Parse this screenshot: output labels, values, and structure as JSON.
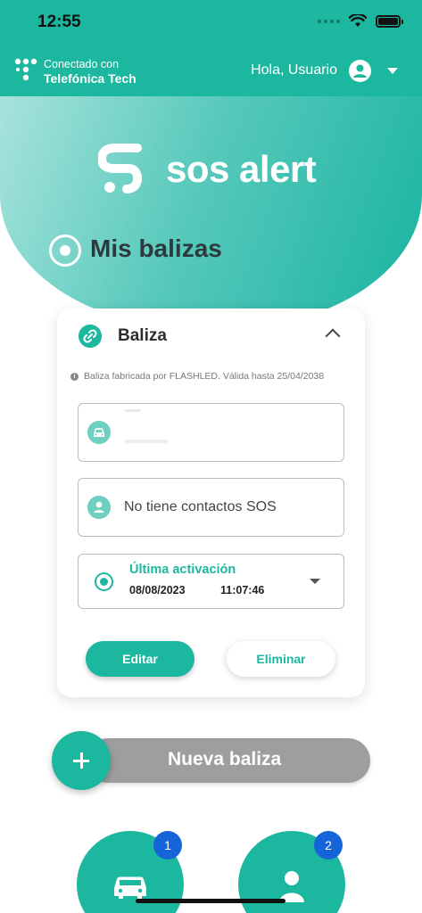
{
  "status_bar": {
    "time": "12:55"
  },
  "app_bar": {
    "brand_line1": "Conectado con",
    "brand_line2": "Telefónica Tech",
    "greeting": "Hola, Usuario"
  },
  "hero": {
    "logo_text": "sos alert",
    "section_title": "Mis balizas"
  },
  "beacon_card": {
    "title": "Baliza",
    "info": "Baliza fabricada por FLASHLED. Válida hasta 25/04/2038",
    "contacts_text": "No tiene contactos SOS",
    "activation_label": "Última activación",
    "activation_date": "08/08/2023",
    "activation_time": "11:07:46",
    "edit_label": "Editar",
    "delete_label": "Eliminar"
  },
  "new_beacon": {
    "label": "Nueva baliza"
  },
  "bottom_nav": {
    "vehicles_badge": "1",
    "contacts_badge": "2"
  },
  "colors": {
    "accent": "#1cb79f",
    "badge": "#1565d8",
    "disabled": "#9e9e9e"
  },
  "icons": [
    "wifi-icon",
    "battery-icon",
    "telefonica-logo-icon",
    "user-icon",
    "chevron-down-icon",
    "sos-logo-icon",
    "radio-icon",
    "link-icon",
    "chevron-up-icon",
    "info-icon",
    "car-icon",
    "person-icon",
    "plus-icon"
  ]
}
